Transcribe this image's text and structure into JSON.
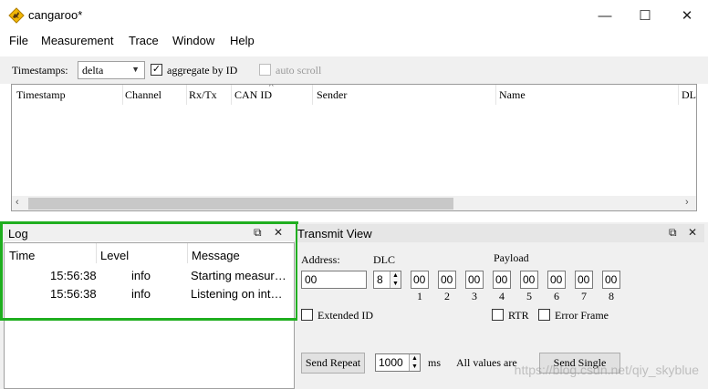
{
  "window": {
    "title": "cangaroo*",
    "minimize_glyph": "—",
    "maximize_glyph": "☐",
    "close_glyph": "✕"
  },
  "menu": [
    "File",
    "Measurement",
    "Trace",
    "Window",
    "Help"
  ],
  "toolbar": {
    "timestamps_label": "Timestamps:",
    "timestamps_value": "delta",
    "aggregate_label": "aggregate by ID",
    "aggregate_checked": true,
    "autoscroll_label": "auto scroll",
    "autoscroll_checked": false
  },
  "trace": {
    "columns": [
      "Timestamp",
      "Channel",
      "Rx/Tx",
      "CAN ID",
      "Sender",
      "Name",
      "DLC"
    ],
    "sort_glyph": "^"
  },
  "log": {
    "title": "Log",
    "columns": [
      "Time",
      "Level",
      "Message"
    ],
    "rows": [
      {
        "time": "15:56:38",
        "level": "info",
        "message": "Starting measur…"
      },
      {
        "time": "15:56:38",
        "level": "info",
        "message": "Listening on int…"
      }
    ]
  },
  "transmit": {
    "title": "Transmit View",
    "address_label": "Address:",
    "address_value": "00",
    "dlc_label": "DLC",
    "dlc_value": "8",
    "payload_label": "Payload",
    "payload": [
      "00",
      "00",
      "00",
      "00",
      "00",
      "00",
      "00",
      "00"
    ],
    "indices": [
      "1",
      "2",
      "3",
      "4",
      "5",
      "6",
      "7",
      "8"
    ],
    "extended_id_label": "Extended ID",
    "rtr_label": "RTR",
    "error_frame_label": "Error Framе",
    "send_repeat_label": "Send Repeat",
    "interval_value": "1000",
    "ms_label": "ms",
    "all_values_label": "All values are",
    "send_single_label": "Send Single"
  },
  "panel_buttons": {
    "float_glyph": "⧉",
    "close_glyph": "✕"
  },
  "icons": {
    "app": "kangaroo-icon"
  },
  "colors": {
    "highlight_box": "#1fae1f"
  },
  "watermark": "https://blog.csdn.net/qiy_skyblue"
}
